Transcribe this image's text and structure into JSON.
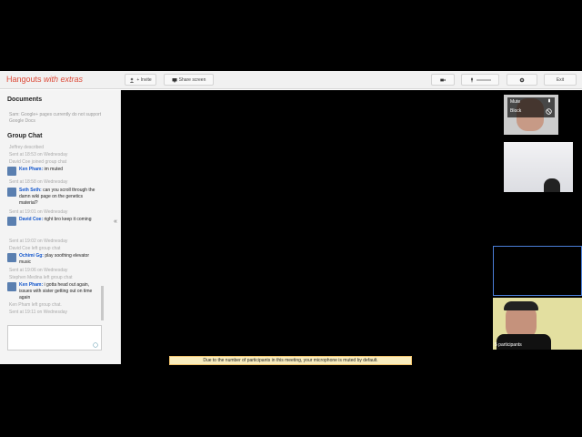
{
  "app": {
    "title_main": "Hangouts",
    "title_extra": "with extras"
  },
  "toolbar": {
    "invite_label": "+ Invite",
    "share_label": "Share screen",
    "mic_label": "",
    "exit_label": "Exit"
  },
  "documents": {
    "title": "Documents",
    "note": "Sam: Google+ pages currently do not support Google Docs"
  },
  "group_chat": {
    "title": "Group Chat",
    "messages": [
      {
        "kind": "sys",
        "text": "Jeffrey described"
      },
      {
        "kind": "time",
        "text": "Sent at 18:53 on Wednesday"
      },
      {
        "kind": "sys",
        "text": "David Coe joined group chat"
      },
      {
        "kind": "user",
        "name": "Ken Pham:",
        "text": "im muted"
      },
      {
        "kind": "time",
        "text": "Sent at 18:58 on Wednesday"
      },
      {
        "kind": "user",
        "name": "Seth Seth:",
        "text": "can you scroll through the damn wiki page on the genetics material?"
      },
      {
        "kind": "time",
        "text": "Sent at 19:01 on Wednesday"
      },
      {
        "kind": "user",
        "name": "David Coe:",
        "text": "right bro keep it coming"
      },
      {
        "kind": "time",
        "text": "Sent at 19:02 on Wednesday"
      },
      {
        "kind": "sys",
        "text": "David Coe left group chat"
      },
      {
        "kind": "user",
        "name": "Ochimi Gg:",
        "text": "play soothing elevator music"
      },
      {
        "kind": "time",
        "text": "Sent at 19:06 on Wednesday"
      },
      {
        "kind": "sys",
        "text": "Stephen Medina left group chat"
      },
      {
        "kind": "user",
        "name": "Ken Pham:",
        "text": "i gotta head out again, issues with sister getting out on time again"
      },
      {
        "kind": "sys",
        "text": "Ken Pham left group chat."
      },
      {
        "kind": "time",
        "text": "Sent at 19:11 on Wednesday"
      }
    ]
  },
  "stage": {
    "thumb_menu": {
      "mute": "Mute",
      "block": "Block"
    },
    "participants_label": "5 participants"
  },
  "notice": "Due to the number of participants in this meeting, your microphone is muted by default."
}
